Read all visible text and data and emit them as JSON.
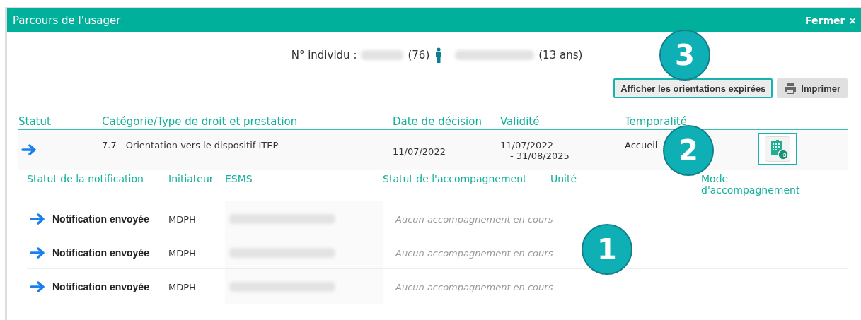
{
  "window": {
    "title": "Parcours de l'usager",
    "close": "Fermer ×"
  },
  "individual": {
    "label": "N° individu :",
    "count": "(76)",
    "age": "(13 ans)"
  },
  "buttons": [
    {
      "label": "Afficher les orientations expirées",
      "kind": "toggle",
      "highlighted": true
    },
    {
      "label": "Imprimer",
      "kind": "print",
      "highlighted": false
    }
  ],
  "table": {
    "columns": [
      "Statut",
      "Catégorie/Type de droit et prestation",
      "Date de décision",
      "Validité",
      "Temporalité"
    ],
    "rows": [
      {
        "category": "7.7 - Orientation vers le dispositif ITEP",
        "decision_date": "11/07/2022",
        "validity_start": "11/07/2022",
        "validity_end": "- 31/08/2025",
        "temporality": "Accueil",
        "establishments_badge": "3"
      }
    ]
  },
  "notifications": {
    "columns": [
      "Statut de la notification",
      "Initiateur",
      "ESMS",
      "Statut de l'accompagnement",
      "Unité",
      "Mode d'accompagnement"
    ],
    "rows": [
      {
        "status": "Notification envoyée",
        "initiator": "MDPH",
        "support_status": "Aucun accompagnement en cours"
      },
      {
        "status": "Notification envoyée",
        "initiator": "MDPH",
        "support_status": "Aucun accompagnement en cours"
      },
      {
        "status": "Notification envoyée",
        "initiator": "MDPH",
        "support_status": "Aucun accompagnement en cours"
      }
    ]
  },
  "callouts": [
    {
      "label": "3"
    },
    {
      "label": "2"
    },
    {
      "label": "1"
    }
  ]
}
